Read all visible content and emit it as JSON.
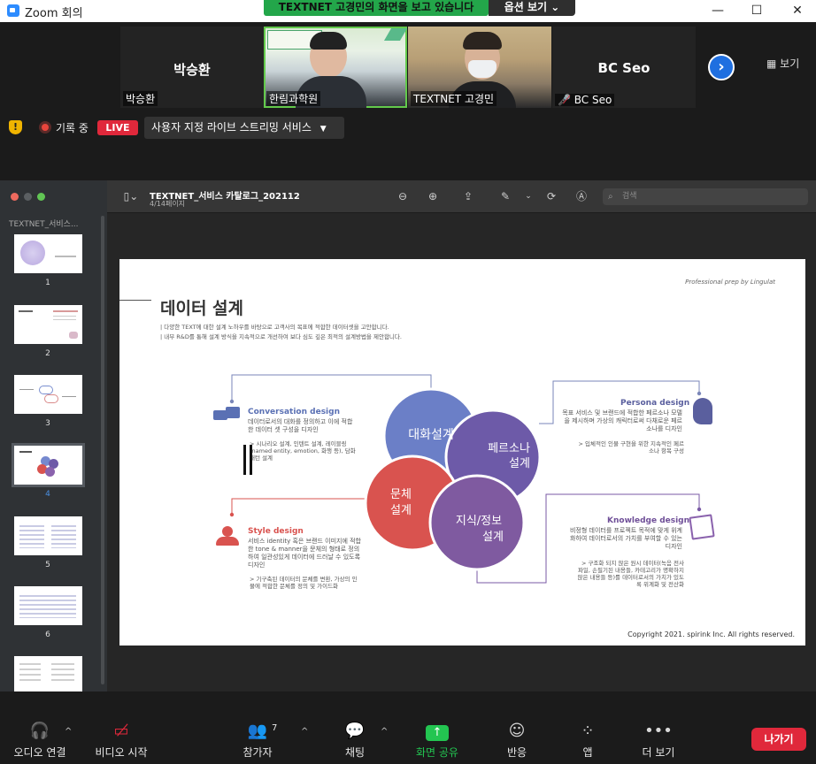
{
  "window": {
    "title": "Zoom 회의"
  },
  "share_banner": {
    "text": "TEXTNET 고경민의 화면을 보고 있습니다",
    "options_label": "옵션 보기"
  },
  "participants": [
    {
      "big_name": "박승환",
      "name_tag": "박승환",
      "video": false
    },
    {
      "big_name": "",
      "name_tag": "한림과학원",
      "video": true
    },
    {
      "big_name": "",
      "name_tag": "TEXTNET 고경민",
      "video": true
    },
    {
      "big_name": "BC Seo",
      "name_tag": "BC Seo",
      "video": false,
      "muted": true
    }
  ],
  "view_button": "보기",
  "recording": {
    "label": "기록 중",
    "live_badge": "LIVE",
    "stream_label": "사용자 지정 라이브 스트리밍 서비스"
  },
  "sidebar": {
    "title": "TEXTNET_서비스...",
    "pages": [
      "1",
      "2",
      "3",
      "4",
      "5",
      "6"
    ],
    "selected": "4"
  },
  "viewer": {
    "doc_title": "TEXTNET_서비스 카탈로그_202112",
    "page_info": "4/14페이지",
    "search_placeholder": "검색"
  },
  "slide": {
    "header_note": "Professional prep by Lingulat",
    "title": "데이터 설계",
    "sub1": "| 다양한 TEXT에 대한 설계 노하우를 바탕으로 고객사의 목표에 적합한 데이터셋을 고안합니다.",
    "sub2": "| 내부 R&D를 통해 설계 방식을 지속적으로 개선하여 보다 심도 깊은 최적의 설계방법을 제안합니다.",
    "circles": [
      "대화설계",
      "페르소나\n설계",
      "문체\n설계",
      "지식/정보\n설계"
    ],
    "blocks": {
      "conversation": {
        "title": "Conversation design",
        "text": "데이터로서의 대화를 정의하고 이에 적합한 데이터 셋 구성을 디자인",
        "bullet": "시나리오 설계, 인텐트 설계, 레이블링 (named entity, emotion, 화행 등), 담화 패턴 설계"
      },
      "persona": {
        "title": "Persona design",
        "text": "목표 서비스 및 브랜드에 적합한 페르소나 모델을 제시하며 가상의 캐릭터로써 다채로운 페르소나를 디자인",
        "bullet": "입체적인 인물 구현을 위한 지속적인 페르소나 항목 구성"
      },
      "style": {
        "title": "Style design",
        "text": "서비스 identity 혹은 브랜드 이미지에 적합한 tone & manner을 문체의 형태로 정의하여 일관성있게 데이터에 드러날 수 있도록 디자인",
        "bullet": "기구축된 데이터의 문체를 변환, 가상의 인물에 적합한 문체를 정의 및 가이드화"
      },
      "knowledge": {
        "title": "Knowledge design",
        "text": "비정형 데이터를 프로젝트 목적에 맞게 위계화하여 데이터로서의 가치를 부여할 수 있는 디자인",
        "bullet": "구조화 되지 않은 원시 데이터(녹음 전사 파일, 손필기된 내용들, 카테고리가 명확하지 않은 내용들 등)를 데이터로서의 가치가 있도록 위계화 및 전산화"
      }
    },
    "copyright": "Copyright 2021. spirink Inc. All rights reserved."
  },
  "toolbar": {
    "audio": "오디오 연결",
    "video": "비디오 시작",
    "participants": "참가자",
    "participants_count": "7",
    "chat": "채팅",
    "share": "화면 공유",
    "reactions": "반응",
    "apps": "앱",
    "more": "더 보기",
    "leave": "나가기"
  },
  "colors": {
    "share_green": "#23a64a",
    "live_red": "#e0283b",
    "circle_blue": "#6b7fc7",
    "circle_purple": "#6d5aa8",
    "circle_red": "#d9534f",
    "circle_violet": "#7f5aa0"
  }
}
